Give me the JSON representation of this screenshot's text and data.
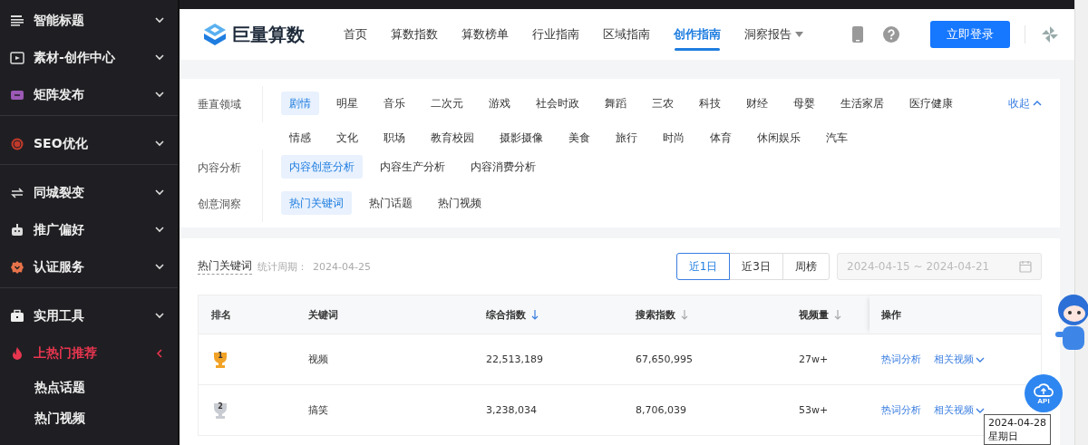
{
  "sidebar": {
    "groups": [
      {
        "items": [
          {
            "label": "智能标题",
            "expanded": false,
            "active": false
          },
          {
            "label": "素材-创作中心",
            "expanded": false,
            "active": false
          },
          {
            "label": "矩阵发布",
            "expanded": false,
            "active": false
          }
        ]
      },
      {
        "items": [
          {
            "label": "SEO优化",
            "expanded": false,
            "active": false
          }
        ]
      },
      {
        "items": [
          {
            "label": "同城裂变",
            "expanded": false,
            "active": false
          },
          {
            "label": "推广偏好",
            "expanded": false,
            "active": false
          },
          {
            "label": "认证服务",
            "expanded": false,
            "active": false
          }
        ]
      },
      {
        "items": [
          {
            "label": "实用工具",
            "expanded": false,
            "active": false
          },
          {
            "label": "上热门推荐",
            "expanded": true,
            "active": true,
            "children": [
              {
                "label": "热点话题"
              },
              {
                "label": "热门视频"
              }
            ]
          }
        ]
      }
    ]
  },
  "nav": {
    "logo": "巨量算数",
    "items": [
      {
        "label": "首页",
        "selected": false,
        "menu": false
      },
      {
        "label": "算数指数",
        "selected": false,
        "menu": false
      },
      {
        "label": "算数榜单",
        "selected": false,
        "menu": false
      },
      {
        "label": "行业指南",
        "selected": false,
        "menu": false
      },
      {
        "label": "区域指南",
        "selected": false,
        "menu": false
      },
      {
        "label": "创作指南",
        "selected": true,
        "menu": false
      },
      {
        "label": "洞察报告",
        "selected": false,
        "menu": true
      }
    ],
    "login": "立即登录"
  },
  "filters": {
    "collapse": "收起",
    "rows": [
      {
        "label": "垂直领域",
        "options": [
          {
            "text": "剧情",
            "selected": true
          },
          {
            "text": "明星",
            "selected": false
          },
          {
            "text": "音乐",
            "selected": false
          },
          {
            "text": "二次元",
            "selected": false
          },
          {
            "text": "游戏",
            "selected": false
          },
          {
            "text": "社会时政",
            "selected": false
          },
          {
            "text": "舞蹈",
            "selected": false
          },
          {
            "text": "三农",
            "selected": false
          },
          {
            "text": "科技",
            "selected": false
          },
          {
            "text": "财经",
            "selected": false
          },
          {
            "text": "母婴",
            "selected": false
          },
          {
            "text": "生活家居",
            "selected": false
          },
          {
            "text": "医疗健康",
            "selected": false
          },
          {
            "text": "情感",
            "selected": false
          },
          {
            "text": "文化",
            "selected": false
          },
          {
            "text": "职场",
            "selected": false
          },
          {
            "text": "教育校园",
            "selected": false
          },
          {
            "text": "摄影摄像",
            "selected": false
          },
          {
            "text": "美食",
            "selected": false
          },
          {
            "text": "旅行",
            "selected": false
          },
          {
            "text": "时尚",
            "selected": false
          },
          {
            "text": "体育",
            "selected": false
          },
          {
            "text": "休闲娱乐",
            "selected": false
          },
          {
            "text": "汽车",
            "selected": false
          }
        ]
      },
      {
        "label": "内容分析",
        "options": [
          {
            "text": "内容创意分析",
            "selected": true
          },
          {
            "text": "内容生产分析",
            "selected": false
          },
          {
            "text": "内容消费分析",
            "selected": false
          }
        ]
      },
      {
        "label": "创意洞察",
        "options": [
          {
            "text": "热门关键词",
            "selected": true
          },
          {
            "text": "热门话题",
            "selected": false
          },
          {
            "text": "热门视频",
            "selected": false
          }
        ]
      }
    ]
  },
  "ranking": {
    "title": "热门关键词",
    "period_label": "统计周期：",
    "period": "2024-04-25",
    "tabs": [
      {
        "label": "近1日",
        "selected": true
      },
      {
        "label": "近3日",
        "selected": false
      },
      {
        "label": "周榜",
        "selected": false
      }
    ],
    "date_range": "2024-04-15 ~ 2024-04-21",
    "columns": [
      {
        "label": "排名",
        "sortable": false,
        "sorted": false
      },
      {
        "label": "关键词",
        "sortable": false,
        "sorted": false
      },
      {
        "label": "综合指数",
        "sortable": true,
        "sorted": true
      },
      {
        "label": "搜索指数",
        "sortable": true,
        "sorted": false
      },
      {
        "label": "视频量",
        "sortable": true,
        "sorted": false
      },
      {
        "label": "操作",
        "sortable": false,
        "sorted": false
      }
    ],
    "rows": [
      {
        "rank": "1",
        "color": "#f2a327",
        "keyword": "视频",
        "composite": "22,513,189",
        "search": "67,650,995",
        "videos": "27w+",
        "actions": [
          "热词分析",
          "相关视频"
        ]
      },
      {
        "rank": "2",
        "color": "#c9ccd2",
        "keyword": "搞笑",
        "composite": "3,238,034",
        "search": "8,706,039",
        "videos": "53w+",
        "actions": [
          "热词分析",
          "相关视频"
        ]
      }
    ]
  },
  "api_button": "API",
  "tooltip": {
    "date": "2024-04-28",
    "weekday": "星期日"
  }
}
